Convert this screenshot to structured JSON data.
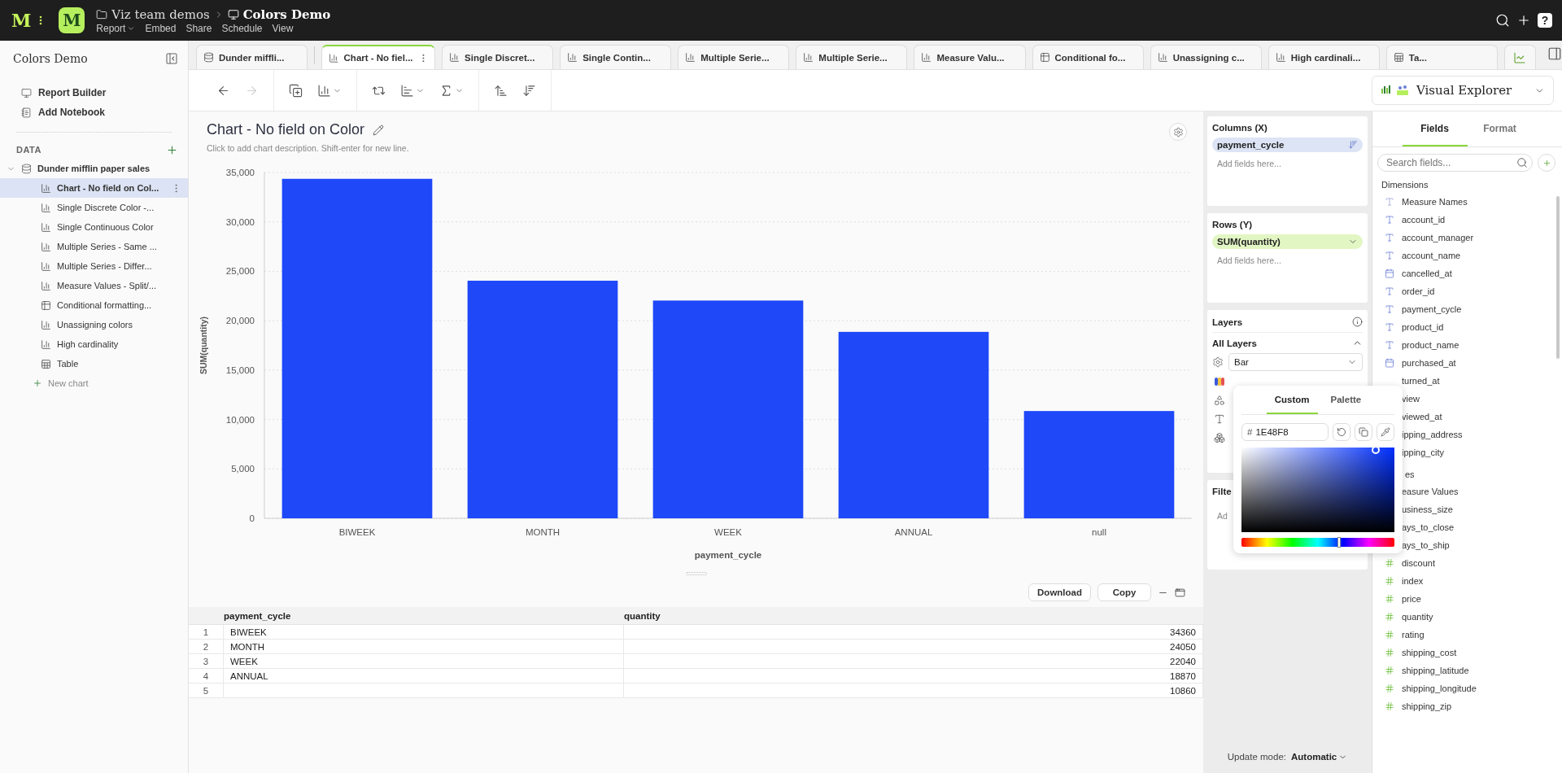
{
  "topbar": {
    "brand": "M",
    "app_icon": "M",
    "breadcrumb": [
      {
        "label": "Viz team demos",
        "kind": "folder"
      },
      {
        "label": "Colors Demo",
        "kind": "report"
      }
    ],
    "menu": [
      {
        "label": "Report",
        "dropdown": true
      },
      {
        "label": "Embed",
        "dropdown": false
      },
      {
        "label": "Share",
        "dropdown": false
      },
      {
        "label": "Schedule",
        "dropdown": false
      },
      {
        "label": "View",
        "dropdown": false
      }
    ],
    "help": "?"
  },
  "sidebar": {
    "title": "Colors Demo",
    "links": [
      {
        "label": "Report Builder",
        "kind": "report"
      },
      {
        "label": "Add Notebook",
        "kind": "notebook"
      }
    ],
    "data_heading": "DATA",
    "datasets": [
      {
        "label": "Dunder mifflin paper sales",
        "expanded": true,
        "children": [
          {
            "label": "Chart - No field on Col...",
            "kind": "chart",
            "selected": true
          },
          {
            "label": "Single Discrete Color -...",
            "kind": "chart",
            "selected": false
          },
          {
            "label": "Single Continuous Color",
            "kind": "chart",
            "selected": false
          },
          {
            "label": "Multiple Series - Same ...",
            "kind": "chart",
            "selected": false
          },
          {
            "label": "Multiple Series - Differ...",
            "kind": "chart",
            "selected": false
          },
          {
            "label": "Measure Values - Split/...",
            "kind": "chart",
            "selected": false
          },
          {
            "label": "Conditional formatting...",
            "kind": "table",
            "selected": false
          },
          {
            "label": "Unassigning colors",
            "kind": "chart",
            "selected": false
          },
          {
            "label": "High cardinality",
            "kind": "chart",
            "selected": false
          },
          {
            "label": "Table",
            "kind": "grid",
            "selected": false
          }
        ]
      }
    ],
    "new_chart": "New chart"
  },
  "tabs": [
    {
      "label": "Dunder miffli...",
      "kind": "dataset",
      "selected": false
    },
    {
      "label": "Chart - No fiel...",
      "kind": "chart",
      "selected": true
    },
    {
      "label": "Single Discret...",
      "kind": "chart",
      "selected": false
    },
    {
      "label": "Single Contin...",
      "kind": "chart",
      "selected": false
    },
    {
      "label": "Multiple Serie...",
      "kind": "chart",
      "selected": false
    },
    {
      "label": "Multiple Serie...",
      "kind": "chart",
      "selected": false
    },
    {
      "label": "Measure Valu...",
      "kind": "chart",
      "selected": false
    },
    {
      "label": "Conditional fo...",
      "kind": "table",
      "selected": false
    },
    {
      "label": "Unassigning c...",
      "kind": "chart",
      "selected": false
    },
    {
      "label": "High cardinali...",
      "kind": "chart",
      "selected": false
    },
    {
      "label": "Ta...",
      "kind": "grid",
      "selected": false
    }
  ],
  "toolbar": {
    "groups": [
      [
        {
          "kind": "back",
          "disabled": false,
          "menu": false
        },
        {
          "kind": "forward",
          "disabled": true,
          "menu": false
        }
      ],
      [
        {
          "kind": "add_layer",
          "disabled": false,
          "menu": false
        },
        {
          "kind": "chart_clear",
          "disabled": false,
          "menu": true
        }
      ],
      [
        {
          "kind": "swap_axes",
          "disabled": false,
          "menu": false
        },
        {
          "kind": "axis",
          "disabled": false,
          "menu": true
        },
        {
          "kind": "aggregate",
          "disabled": false,
          "menu": true
        }
      ],
      [
        {
          "kind": "sort_ascending",
          "disabled": false,
          "menu": false
        },
        {
          "kind": "sort_descending",
          "disabled": false,
          "menu": false
        }
      ]
    ]
  },
  "visual_explorer": {
    "label": "Visual Explorer"
  },
  "chart": {
    "title": "Chart - No field on Color",
    "description": "Click to add chart description. Shift-enter for new line.",
    "chart_data": {
      "type": "bar",
      "xlabel": "payment_cycle",
      "ylabel": "SUM(quantity)",
      "categories": [
        "BIWEEK",
        "MONTH",
        "WEEK",
        "ANNUAL",
        "null"
      ],
      "grid": true,
      "series": [
        {
          "color": "#1e48f8",
          "values": [
            34360,
            24050,
            22040,
            18870,
            10860
          ]
        }
      ],
      "ylim": [
        0,
        35000
      ],
      "yticks": [
        {
          "value": 0,
          "label": "0"
        },
        {
          "value": 5000,
          "label": "5,000"
        },
        {
          "value": 10000,
          "label": "10,000"
        },
        {
          "value": 15000,
          "label": "15,000"
        },
        {
          "value": 20000,
          "label": "20,000"
        },
        {
          "value": 25000,
          "label": "25,000"
        },
        {
          "value": 30000,
          "label": "30,000"
        },
        {
          "value": 35000,
          "label": "35,000"
        }
      ]
    }
  },
  "table": {
    "buttons": [
      "Download",
      "Copy"
    ],
    "columns": [
      "payment_cycle",
      "quantity"
    ],
    "rows": [
      {
        "number": "1",
        "cells": [
          "BIWEEK",
          "34360"
        ]
      },
      {
        "number": "2",
        "cells": [
          "MONTH",
          "24050"
        ]
      },
      {
        "number": "3",
        "cells": [
          "WEEK",
          "22040"
        ]
      },
      {
        "number": "4",
        "cells": [
          "ANNUAL",
          "18870"
        ]
      },
      {
        "number": "5",
        "cells": [
          null,
          "10860"
        ]
      }
    ]
  },
  "shelves": [
    {
      "title": "Columns (X)",
      "pill": {
        "label": "payment_cycle",
        "kind": "dimension"
      },
      "drop_hint": "Add fields here..."
    },
    {
      "title": "Rows (Y)",
      "pill": {
        "label": "SUM(quantity)",
        "kind": "measure"
      },
      "drop_hint": "Add fields here..."
    }
  ],
  "layers": {
    "title": "Layers",
    "group": "All Layers",
    "expanded": true,
    "mark_type": "Bar"
  },
  "filters": {
    "title": "Filte",
    "drop_hint": "Ad"
  },
  "update_mode": {
    "label": "Update mode:",
    "value": "Automatic"
  },
  "color_picker": {
    "tabs": [
      {
        "label": "Custom",
        "selected": true
      },
      {
        "label": "Palette",
        "selected": false
      }
    ],
    "prefix": "#",
    "hex": "1E48F8",
    "hue": {
      "level": 0.636
    }
  },
  "fields_panel": {
    "tabs": [
      {
        "label": "Fields",
        "selected": true
      },
      {
        "label": "Format",
        "selected": false
      }
    ],
    "search": {
      "placeholder": "Search fields..."
    },
    "sections": [
      {
        "title": "Dimensions",
        "fields": [
          {
            "label": "Measure Names",
            "kind": "measure_names"
          },
          {
            "label": "account_id",
            "kind": "text"
          },
          {
            "label": "account_manager",
            "kind": "text"
          },
          {
            "label": "account_name",
            "kind": "text"
          },
          {
            "label": "cancelled_at",
            "kind": "date"
          },
          {
            "label": "order_id",
            "kind": "text"
          },
          {
            "label": "payment_cycle",
            "kind": "text"
          },
          {
            "label": "product_id",
            "kind": "text"
          },
          {
            "label": "product_name",
            "kind": "text"
          },
          {
            "label": "purchased_at",
            "kind": "date"
          },
          {
            "label": "turned_at"
          },
          {
            "label": "view"
          },
          {
            "label": "viewed_at"
          },
          {
            "label": "ipping_address"
          },
          {
            "label": "ipping_city"
          }
        ]
      },
      {
        "title": "es",
        "fields": [
          {
            "label": "easure Values"
          },
          {
            "label": "usiness_size"
          },
          {
            "label": "ays_to_close"
          },
          {
            "label": "ays_to_ship"
          },
          {
            "label": "discount",
            "kind": "number"
          },
          {
            "label": "index",
            "kind": "number"
          },
          {
            "label": "price",
            "kind": "number"
          },
          {
            "label": "quantity",
            "kind": "number"
          },
          {
            "label": "rating",
            "kind": "number"
          },
          {
            "label": "shipping_cost",
            "kind": "number"
          },
          {
            "label": "shipping_latitude",
            "kind": "number"
          },
          {
            "label": "shipping_longitude",
            "kind": "number"
          },
          {
            "label": "shipping_zip",
            "kind": "number"
          }
        ]
      }
    ]
  }
}
